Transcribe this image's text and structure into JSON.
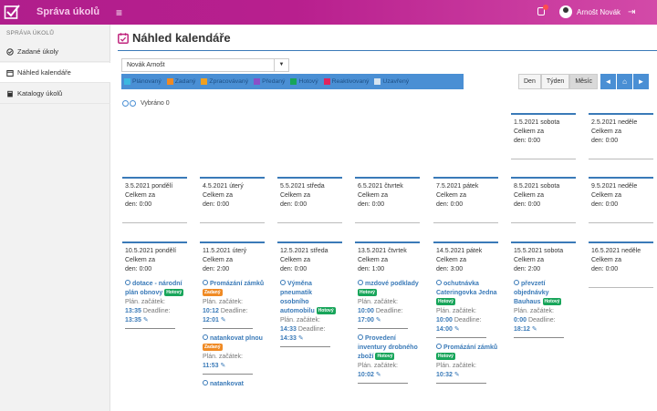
{
  "app": {
    "title": "Správa úkolů",
    "user": "Arnošt Novák"
  },
  "sidebar": {
    "heading": "SPRÁVA ÚKOLŮ",
    "items": [
      {
        "label": "Zadané úkoly",
        "icon": "check-circle-icon"
      },
      {
        "label": "Náhled kalendáře",
        "icon": "calendar-icon"
      },
      {
        "label": "Katalogy úkolů",
        "icon": "book-icon"
      }
    ]
  },
  "page": {
    "title": "Náhled kalendáře"
  },
  "filter": {
    "user_select": "Novák Arnošt"
  },
  "legend": [
    {
      "label": "Plánovaný",
      "color": "#3cb8e0"
    },
    {
      "label": "Zadaný",
      "color": "#f08a24"
    },
    {
      "label": "Zpracovávaný",
      "color": "#f0a020"
    },
    {
      "label": "Předaný",
      "color": "#8a4fc8"
    },
    {
      "label": "Hotový",
      "color": "#18a55a"
    },
    {
      "label": "Reaktivovaný",
      "color": "#e0245e"
    },
    {
      "label": "Uzavřený",
      "color": "#d6e4f0"
    }
  ],
  "views": {
    "day": "Den",
    "week": "Týden",
    "month": "Měsíc"
  },
  "selected_text": "Vybráno 0",
  "celkem_label": "Celkem za",
  "den_label": "den:",
  "plan_label": "Plán. začátek:",
  "deadline_label": "Deadline:",
  "weeks": [
    [
      {
        "date": "1.5.2021 sobota",
        "total": "0:00",
        "tasks": []
      },
      {
        "date": "2.5.2021 neděle",
        "total": "0:00",
        "tasks": []
      }
    ],
    [
      {
        "date": "3.5.2021 pondělí",
        "total": "0:00",
        "tasks": []
      },
      {
        "date": "4.5.2021 úterý",
        "total": "0:00",
        "tasks": []
      },
      {
        "date": "5.5.2021 středa",
        "total": "0:00",
        "tasks": []
      },
      {
        "date": "6.5.2021 čtvrtek",
        "total": "0:00",
        "tasks": []
      },
      {
        "date": "7.5.2021 pátek",
        "total": "0:00",
        "tasks": []
      },
      {
        "date": "8.5.2021 sobota",
        "total": "0:00",
        "tasks": []
      },
      {
        "date": "9.5.2021 neděle",
        "total": "0:00",
        "tasks": []
      }
    ],
    [
      {
        "date": "10.5.2021 pondělí",
        "total": "0:00",
        "tasks": [
          {
            "title": "dotace - národní plán obnovy",
            "badge": "Hotový",
            "start": "13:35",
            "deadline": "13:35"
          }
        ]
      },
      {
        "date": "11.5.2021 úterý",
        "total": "2:00",
        "tasks": [
          {
            "title": "Promázání zámků",
            "badge": "Zadaný",
            "start": "10:12",
            "deadline": "12:01"
          },
          {
            "title": "natankovat plnou",
            "badge": "Zadaný",
            "start": "11:53",
            "deadline": ""
          },
          {
            "title": "natankovat",
            "badge": "",
            "start": "",
            "deadline": ""
          }
        ]
      },
      {
        "date": "12.5.2021 středa",
        "total": "0:00",
        "tasks": [
          {
            "title": "Výměna pneumatik osobního automobilu",
            "badge": "Hotový",
            "start": "14:33",
            "deadline": "14:33"
          }
        ]
      },
      {
        "date": "13.5.2021 čtvrtek",
        "total": "1:00",
        "tasks": [
          {
            "title": "mzdové podklady",
            "badge": "Hotový",
            "start": "10:00",
            "deadline": "17:00"
          },
          {
            "title": "Provedení inventury drobného zboží",
            "badge": "Hotový",
            "start": "10:02",
            "deadline": ""
          }
        ]
      },
      {
        "date": "14.5.2021 pátek",
        "total": "3:00",
        "tasks": [
          {
            "title": "ochutnávka Cateringovka Jedna",
            "badge": "Hotový",
            "start": "10:00",
            "deadline": "14:00"
          },
          {
            "title": "Promázání zámků",
            "badge": "Hotový",
            "start": "10:32",
            "deadline": ""
          }
        ]
      },
      {
        "date": "15.5.2021 sobota",
        "total": "2:00",
        "tasks": [
          {
            "title": "převzetí objednávky Bauhaus",
            "badge": "Hotový",
            "start": "0:00",
            "deadline": "18:12"
          }
        ]
      },
      {
        "date": "16.5.2021 neděle",
        "total": "0:00",
        "tasks": []
      }
    ]
  ]
}
